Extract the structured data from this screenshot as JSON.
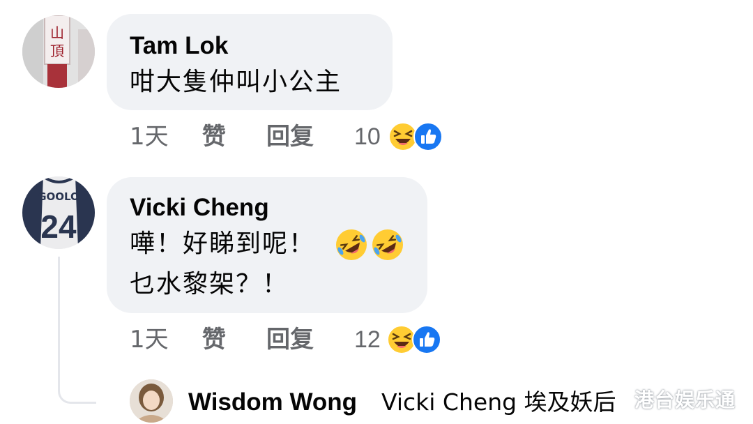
{
  "comments": [
    {
      "author": "Tam Lok",
      "avatar_sign_text": "山頂",
      "lines": [
        "咁大隻仲叫小公主"
      ],
      "time": "1天",
      "like_label": "赞",
      "reply_label": "回复",
      "reaction_count": "10",
      "reactions": [
        "laughing-emoji",
        "like-emoji"
      ]
    },
    {
      "author": "Vicki Cheng",
      "avatar_jersey_name": "GOOLO",
      "avatar_jersey_number": "24",
      "lines": [
        "嘩！好睇到呢！",
        "乜水黎架？！"
      ],
      "inline_emojis": [
        "rofl-emoji",
        "rofl-emoji"
      ],
      "time": "1天",
      "like_label": "赞",
      "reply_label": "回复",
      "reaction_count": "12",
      "reactions": [
        "laughing-emoji",
        "like-emoji"
      ]
    }
  ],
  "reply_preview": {
    "author": "Wisdom Wong",
    "text": "Vicki Cheng 埃及妖后"
  },
  "watermark": "港台娱乐通",
  "colors": {
    "bubble": "#f0f2f5",
    "secondary_text": "#65676b",
    "like_blue": "#1877f2",
    "emoji_yellow": "#ffcc33"
  }
}
